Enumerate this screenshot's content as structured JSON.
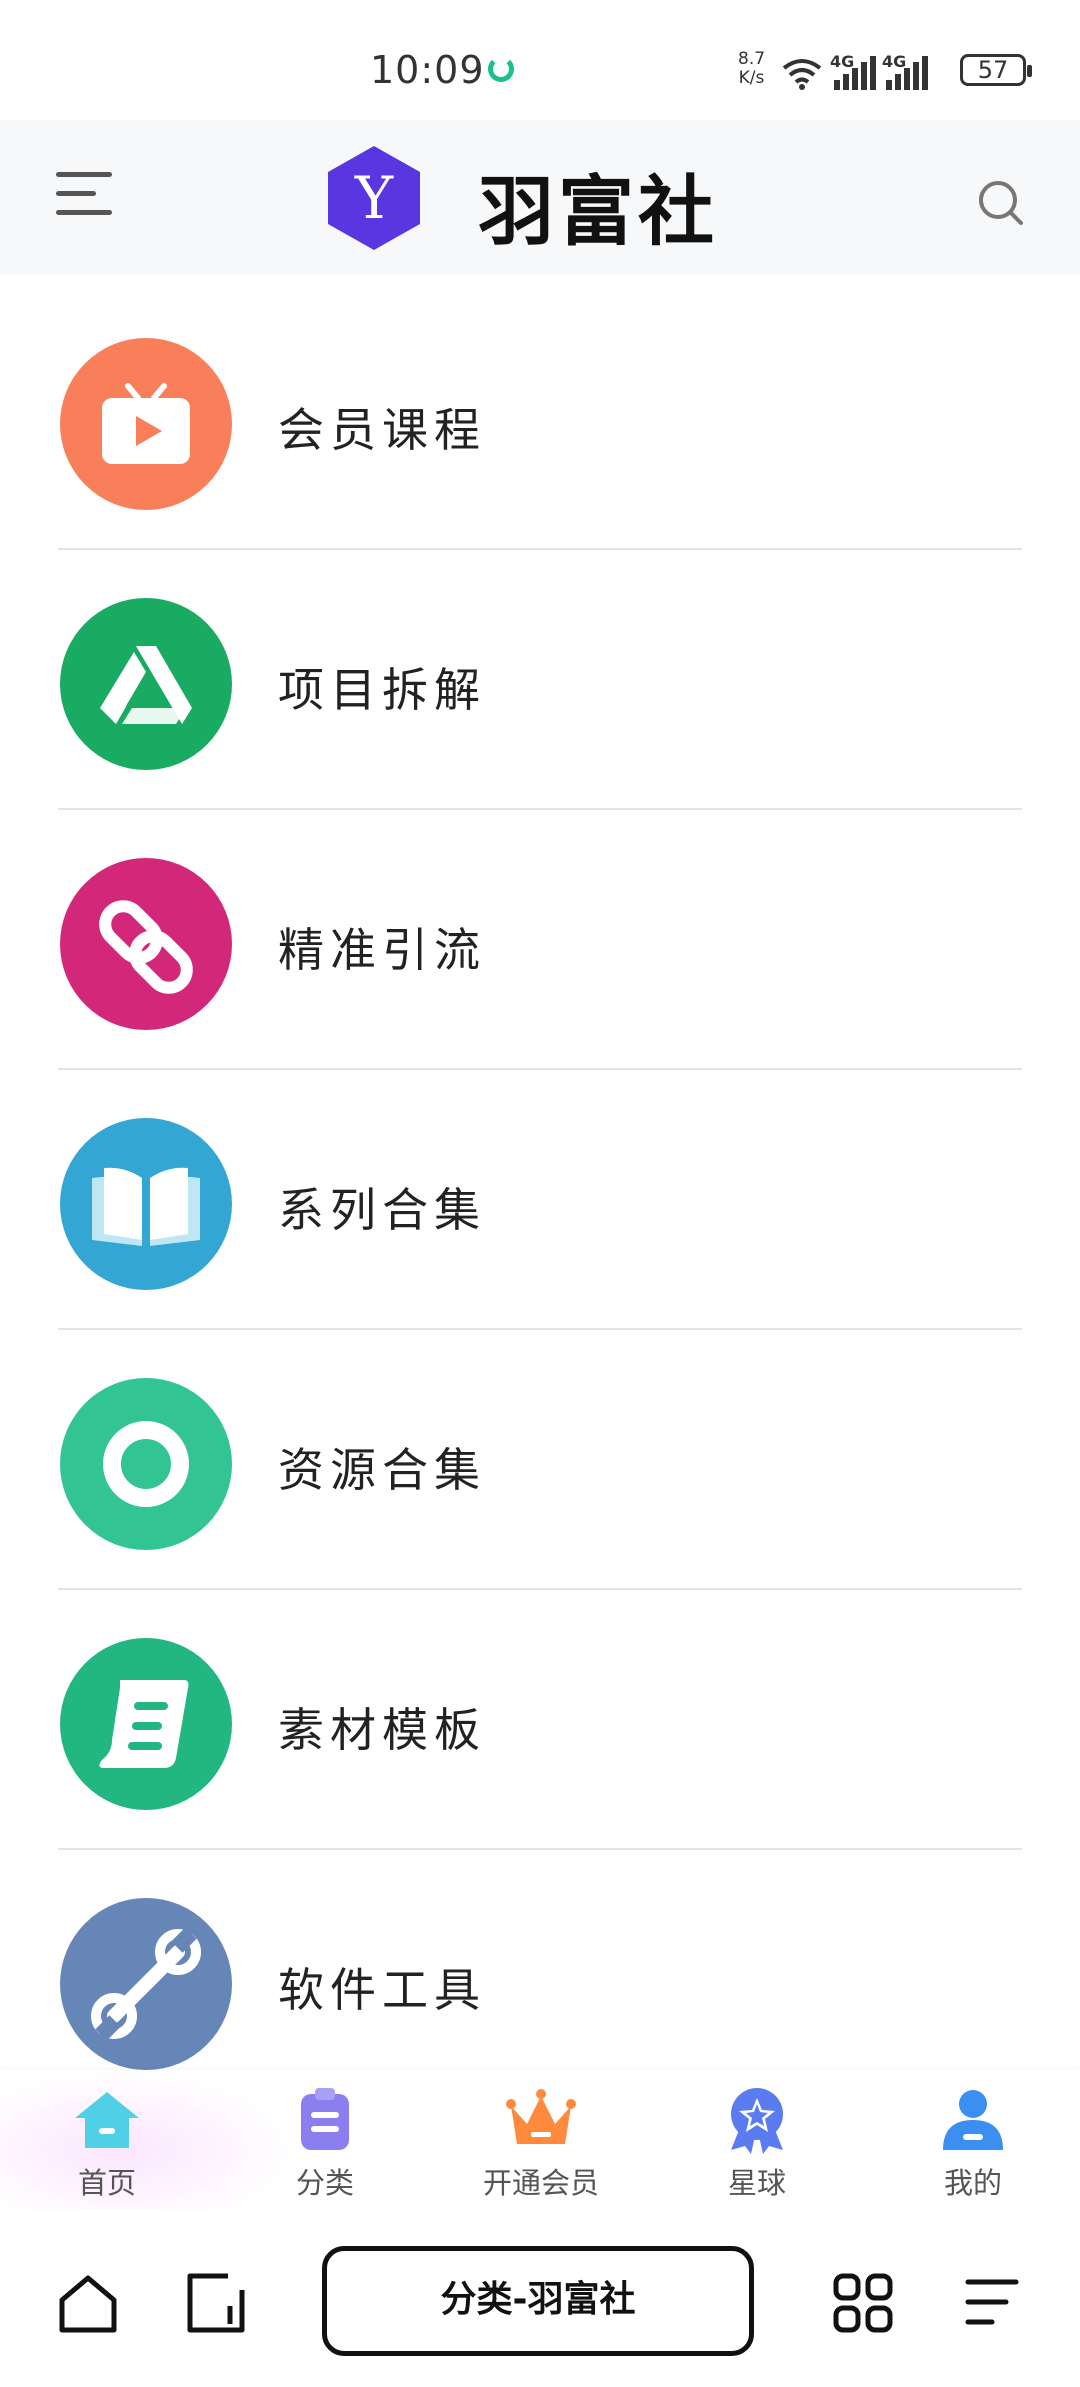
{
  "status_bar": {
    "time": "10:09",
    "net_speed_value": "8.7",
    "net_speed_unit": "K/s",
    "signal1_label": "4G",
    "signal2_label": "4G",
    "battery": "57"
  },
  "header": {
    "logo_letter": "Y",
    "brand": "羽富社"
  },
  "categories": [
    {
      "label": "会员课程",
      "icon": "tv-play-icon",
      "color": "#f97e5a"
    },
    {
      "label": "项目拆解",
      "icon": "triangle-drive-icon",
      "color": "#1aab63"
    },
    {
      "label": "精准引流",
      "icon": "chain-link-icon",
      "color": "#d3287a"
    },
    {
      "label": "系列合集",
      "icon": "open-book-icon",
      "color": "#34a6d3"
    },
    {
      "label": "资源合集",
      "icon": "ring-icon",
      "color": "#33c494"
    },
    {
      "label": "素材模板",
      "icon": "scroll-icon",
      "color": "#22b681"
    },
    {
      "label": "软件工具",
      "icon": "wrench-icon",
      "color": "#6786b8"
    }
  ],
  "tabbar": {
    "tabs": [
      {
        "label": "首页",
        "icon": "home-icon",
        "color": "#4fd0e6"
      },
      {
        "label": "分类",
        "icon": "clipboard-icon",
        "color": "#8b7ff0"
      },
      {
        "label": "开通会员",
        "icon": "crown-icon",
        "color": "#ff8a3d"
      },
      {
        "label": "星球",
        "icon": "star-badge-icon",
        "color": "#5b7cf0"
      },
      {
        "label": "我的",
        "icon": "user-icon",
        "color": "#3a8ff0"
      }
    ]
  },
  "browser": {
    "address": "分类-羽富社"
  }
}
